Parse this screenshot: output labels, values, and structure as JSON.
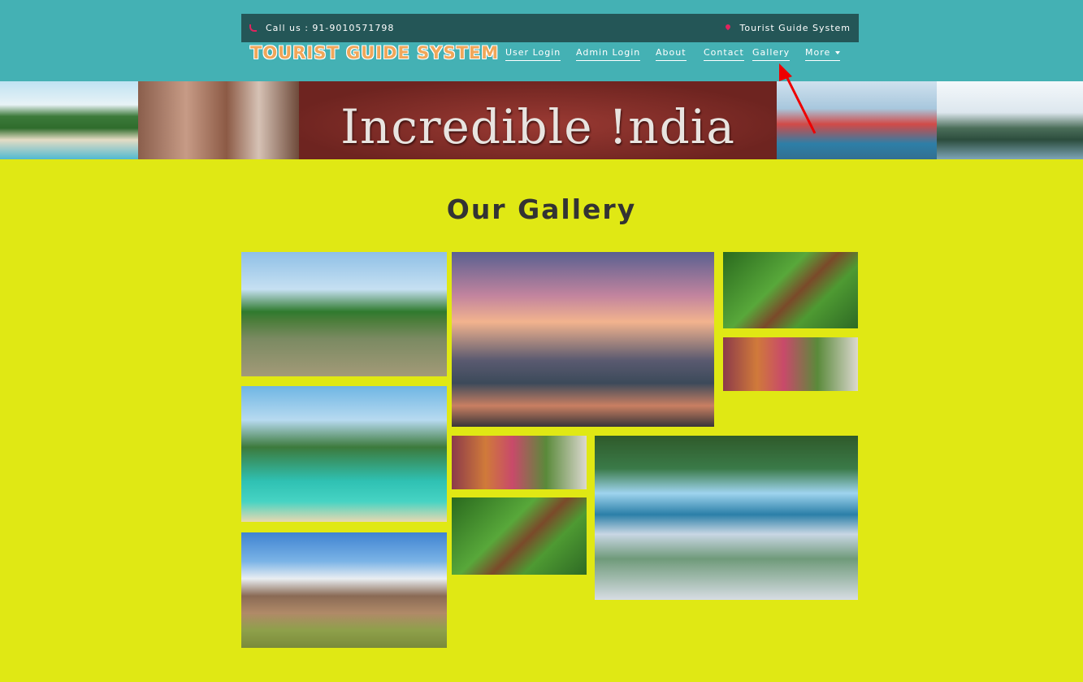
{
  "topbar": {
    "call_text": "Call us : 91-9010571798",
    "location_text": "Tourist Guide System"
  },
  "brand": "TOURIST GUIDE SYSTEM",
  "nav": {
    "user_login": "User Login",
    "admin_login": "Admin Login",
    "about": "About",
    "contact": "Contact",
    "gallery": "Gallery",
    "more": "More"
  },
  "banner": {
    "text": "Incredible !ndia"
  },
  "gallery": {
    "title": "Our Gallery"
  },
  "colors": {
    "header_bg": "#44b1b4",
    "topbar_bg": "#245657",
    "page_bg": "#e0e814",
    "brand": "#f0a75a",
    "accent_pink": "#e0245e",
    "arrow": "#ee0000"
  }
}
